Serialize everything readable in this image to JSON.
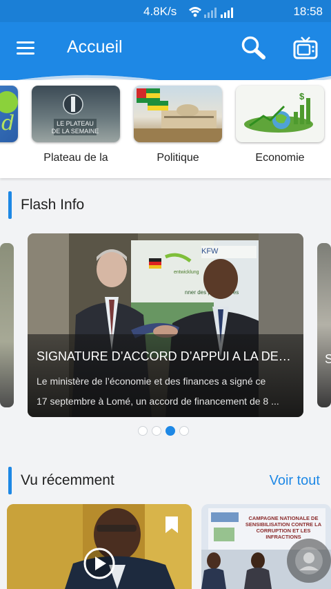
{
  "status_bar": {
    "net_speed": "4.8K/s",
    "time": "18:58"
  },
  "app_bar": {
    "title": "Accueil",
    "menu_icon": "hamburger-icon",
    "search_icon": "search-icon",
    "tv_icon": "tv-icon"
  },
  "categories": [
    {
      "label": "Plateau de la",
      "image_text": "LE PLATEAU DE LA SEMAINE"
    },
    {
      "label": "Politique"
    },
    {
      "label": "Economie"
    }
  ],
  "flash_info": {
    "heading": "Flash Info",
    "card": {
      "title": "SIGNATURE D’ACCORD D’APPUI A LA DECE...",
      "desc_line1": "Le ministère de l’économie et des finances a signé ce",
      "desc_line2": "17 septembre à Lomé, un accord de financement de 8 ...",
      "banner_text": "KFW",
      "banner_sub": "nner des perspectives"
    },
    "pager": {
      "count": 4,
      "active_index": 2
    }
  },
  "recent": {
    "heading": "Vu récemment",
    "see_all": "Voir tout",
    "poster_text": "CAMPAGNE NATIONALE DE SENSIBILISATION CONTRE LA CORRUPTION ET LES INFRACTIONS"
  },
  "colors": {
    "primary": "#1e88e5",
    "statusbar": "#1b7fd6"
  }
}
